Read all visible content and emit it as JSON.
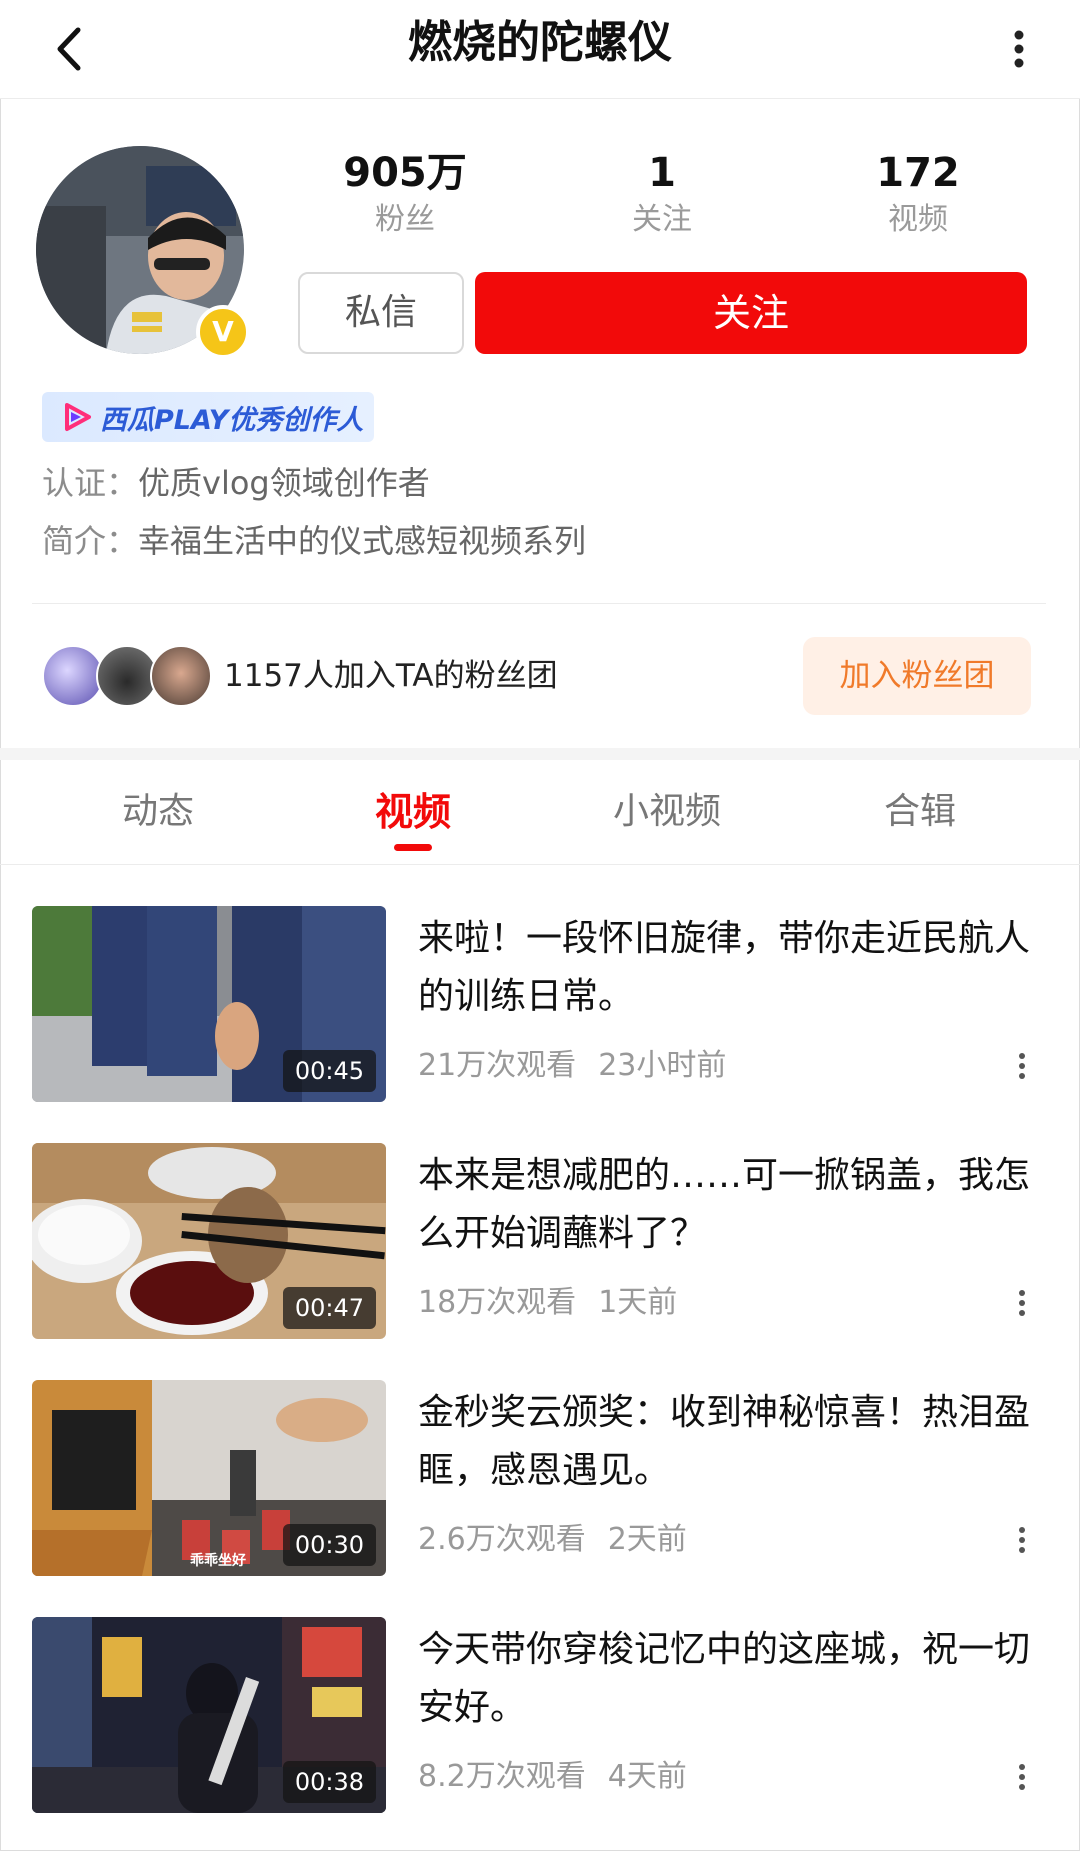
{
  "header": {
    "title": "燃烧的陀螺仪"
  },
  "profile": {
    "verify_badge": "V",
    "stats": [
      {
        "num": "905万",
        "label": "粉丝"
      },
      {
        "num": "1",
        "label": "关注"
      },
      {
        "num": "172",
        "label": "视频"
      }
    ],
    "message_label": "私信",
    "follow_label": "关注",
    "follow_color": "#f20a0a",
    "creator_badge": "西瓜PLAY优秀创作人",
    "certification_label": "认证：",
    "certification_value": "优质vlog领域创作者",
    "intro_label": "简介：",
    "intro_value": "幸福生活中的仪式感短视频系列"
  },
  "fan_club": {
    "text": "1157人加入TA的粉丝团",
    "join_label": "加入粉丝团"
  },
  "tabs": [
    {
      "label": "动态",
      "active": false
    },
    {
      "label": "视频",
      "active": true
    },
    {
      "label": "小视频",
      "active": false
    },
    {
      "label": "合辑",
      "active": false
    }
  ],
  "videos": [
    {
      "title": "来啦！一段怀旧旋律，带你走近民航人的训练日常。",
      "views": "21万次观看",
      "time": "23小时前",
      "duration": "00:45"
    },
    {
      "title": "本来是想减肥的……可一掀锅盖，我怎么开始调蘸料了？",
      "views": "18万次观看",
      "time": "1天前",
      "duration": "00:47"
    },
    {
      "title": "金秒奖云颁奖：收到神秘惊喜！热泪盈眶，感恩遇见。",
      "views": "2.6万次观看",
      "time": "2天前",
      "duration": "00:30",
      "caption": "乖乖坐好"
    },
    {
      "title": "今天带你穿梭记忆中的这座城，祝一切安好。",
      "views": "8.2万次观看",
      "time": "4天前",
      "duration": "00:38"
    }
  ]
}
